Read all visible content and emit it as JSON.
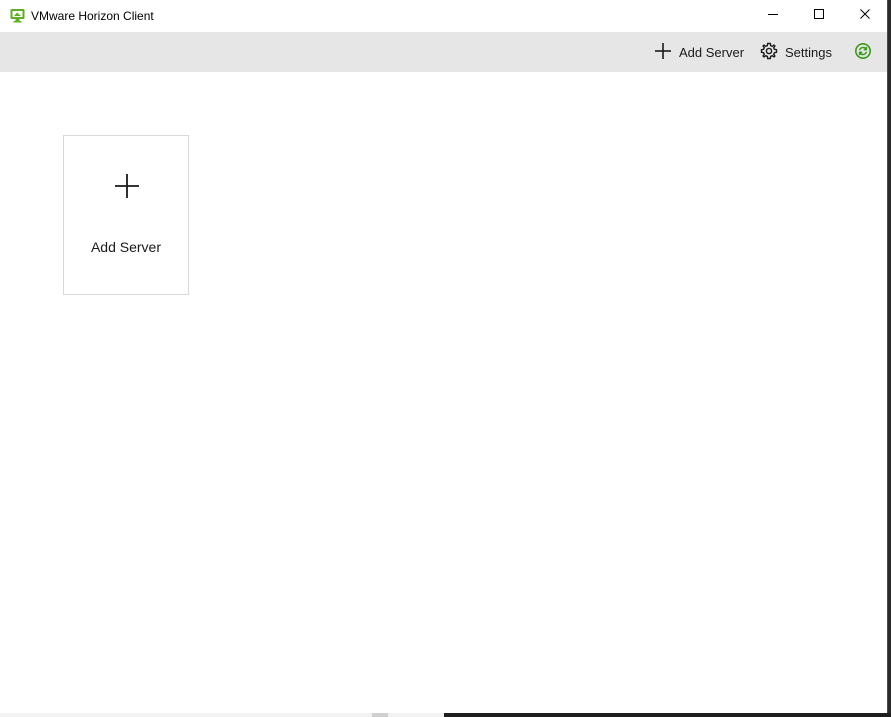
{
  "window": {
    "title": "VMware Horizon Client",
    "app_icon": "vmware-horizon-icon",
    "controls": {
      "minimize_icon": "minimize-icon",
      "maximize_icon": "maximize-icon",
      "close_icon": "close-icon"
    }
  },
  "toolbar": {
    "add_server_label": "Add Server",
    "add_server_icon": "plus-icon",
    "settings_label": "Settings",
    "settings_icon": "gear-icon",
    "refresh_icon": "refresh-icon"
  },
  "main": {
    "tiles": [
      {
        "label": "Add Server",
        "icon": "plus-icon"
      }
    ]
  },
  "colors": {
    "toolbar_bg": "#e6e6e6",
    "accent_green": "#3a9a1a",
    "text": "#1a1a1a",
    "tile_border": "#d9d9d9"
  }
}
